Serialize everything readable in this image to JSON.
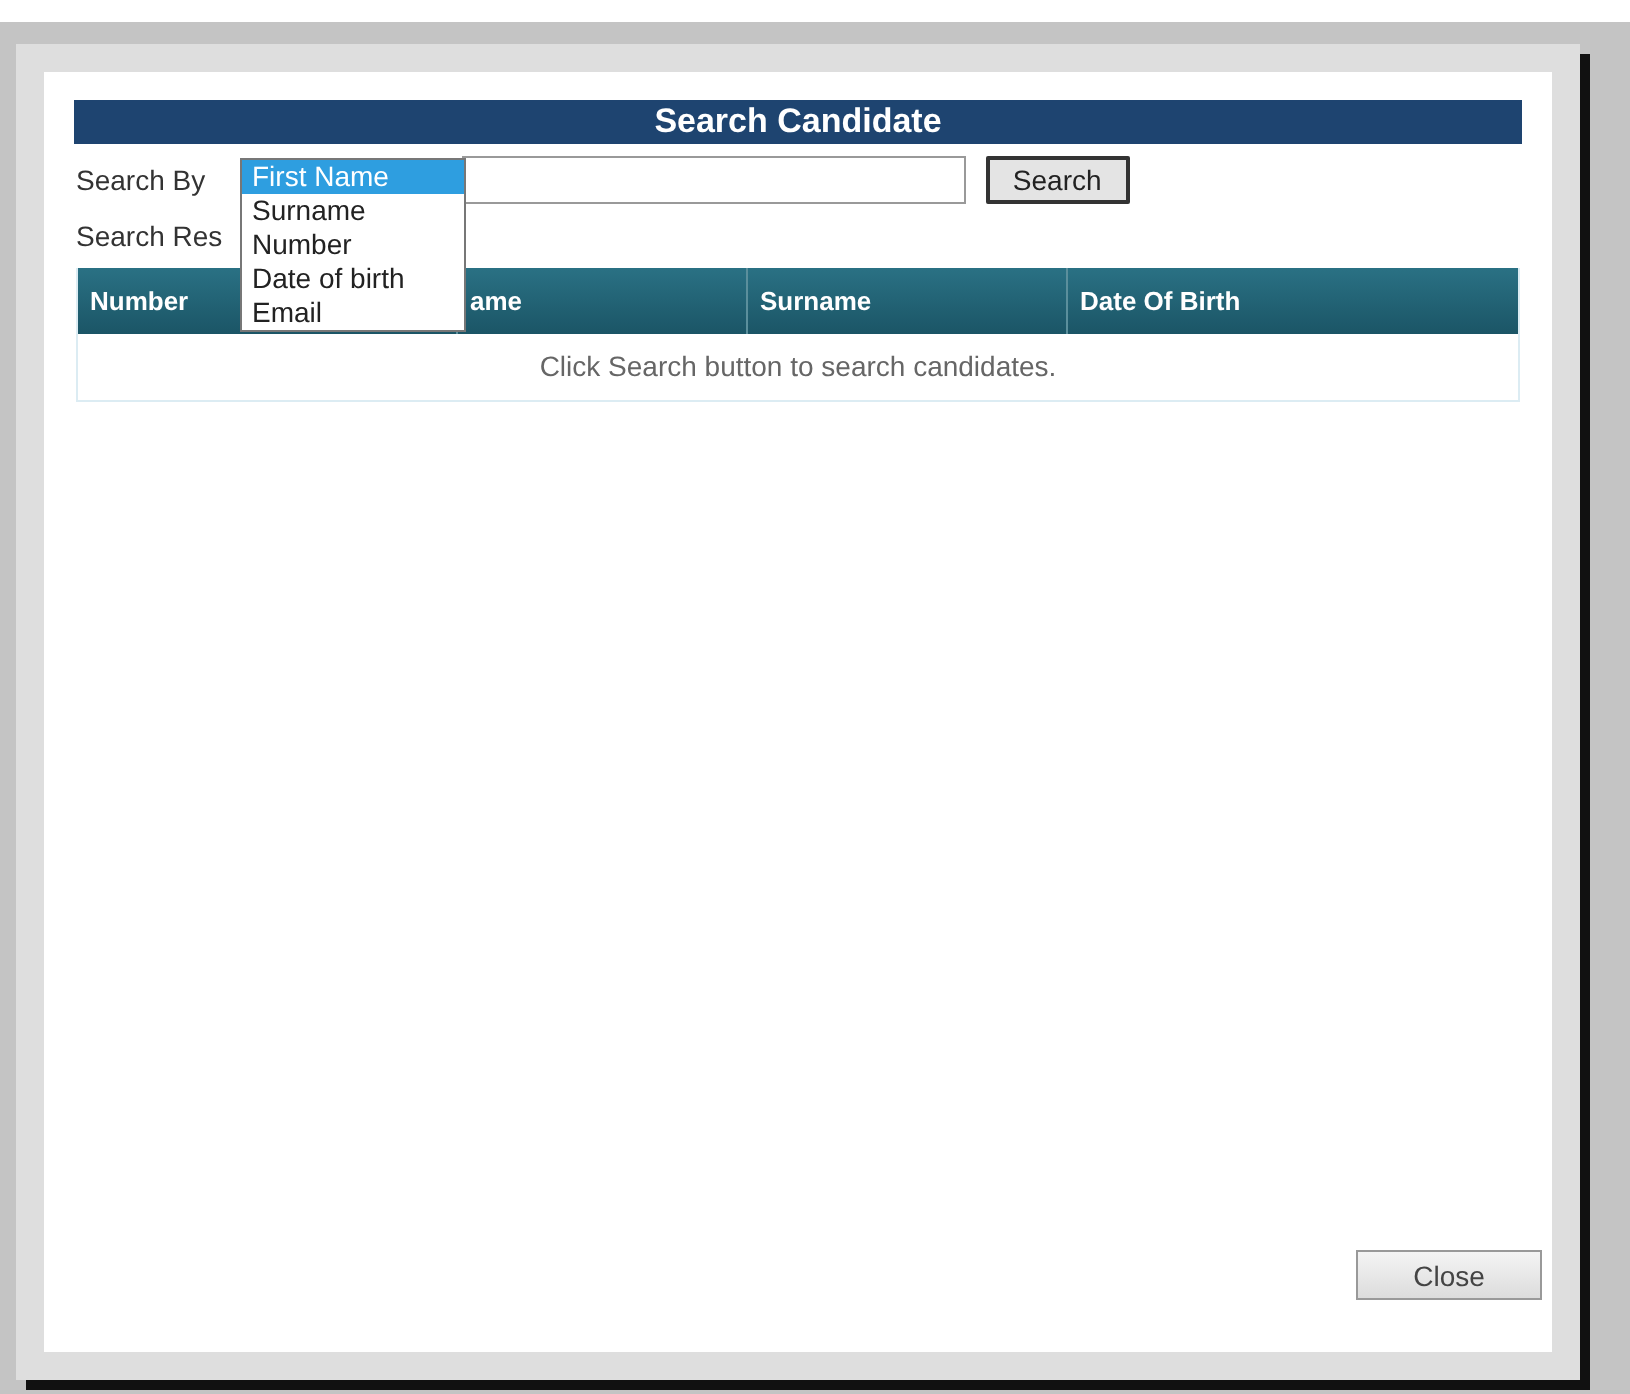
{
  "dialog": {
    "title": "Search Candidate",
    "search_by": {
      "label": "Search By",
      "options": [
        {
          "label": "First Name",
          "selected": true
        },
        {
          "label": "Surname",
          "selected": false
        },
        {
          "label": "Number",
          "selected": false
        },
        {
          "label": "Date of birth",
          "selected": false
        },
        {
          "label": "Email",
          "selected": false
        }
      ],
      "search_button": "Search"
    },
    "results_label": "Search Res",
    "table": {
      "columns": [
        "Number",
        "ame",
        "Surname",
        "Date Of Birth"
      ],
      "empty_message": "Click Search button to search candidates."
    },
    "close_button": "Close"
  }
}
